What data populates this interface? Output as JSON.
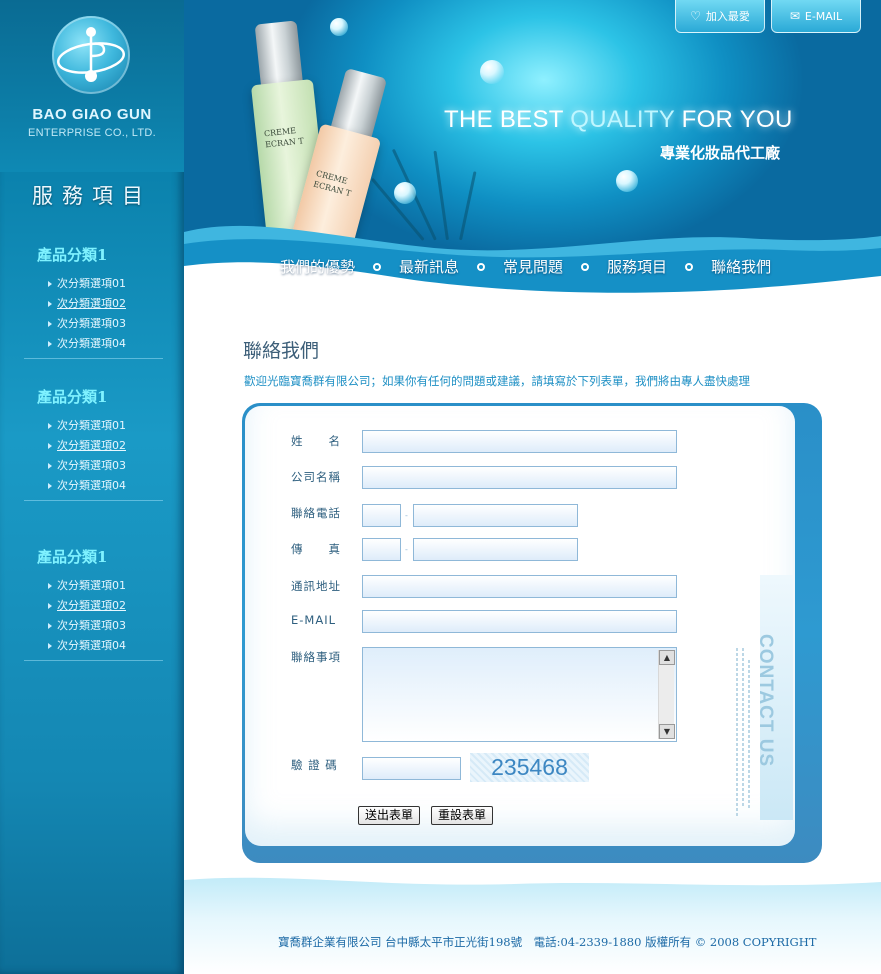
{
  "brand": {
    "name": "BAO GIAO GUN",
    "sub": "ENTERPRISE CO., LTD."
  },
  "sidebar": {
    "title": "服務項目",
    "categories": [
      {
        "title": "產品分類1",
        "items": [
          "次分類選項01",
          "次分類選項02",
          "次分類選項03",
          "次分類選項04"
        ]
      },
      {
        "title": "產品分類1",
        "items": [
          "次分類選項01",
          "次分類選項02",
          "次分類選項03",
          "次分類選項04"
        ]
      },
      {
        "title": "產品分類1",
        "items": [
          "次分類選項01",
          "次分類選項02",
          "次分類選項03",
          "次分類選項04"
        ]
      }
    ]
  },
  "header": {
    "tagline_a": "THE BEST ",
    "tagline_b": "QUALITY",
    "tagline_c": " FOR YOU",
    "subtagline": "專業化妝品代工廠",
    "bottle1_text": "CREME\nECRAN T",
    "bottle2_text": "CREME\nECRAN T",
    "favorite_label": "加入最愛",
    "email_label": "E-MAIL",
    "nav": [
      "我們的優勢",
      "最新訊息",
      "常見問題",
      "服務項目",
      "聯絡我們"
    ]
  },
  "content": {
    "title": "聯絡我們",
    "intro": "歡迎光臨寶喬群有限公司；如果你有任何的問題或建議，請填寫於下列表單，我們將由專人盡快處理",
    "side_label": "CONTACT US",
    "form": {
      "name_label": "姓　　名",
      "company_label": "公司名稱",
      "phone_label": "聯絡電話",
      "fax_label": "傳　　真",
      "address_label": "通訊地址",
      "email_label": "E-MAIL",
      "message_label": "聯絡事項",
      "captcha_label": "驗 證 碼",
      "captcha_value": "235468",
      "submit_label": "送出表單",
      "reset_label": "重設表單"
    }
  },
  "footer": {
    "text": "寶喬群企業有限公司 台中縣太平市正光街198號　電話:04-2339-1880 版權所有 © 2008 COPYRIGHT"
  },
  "colors": {
    "sidebar": "#1487b3",
    "accent": "#1d8fc4",
    "category_title": "#7ff2ff"
  }
}
